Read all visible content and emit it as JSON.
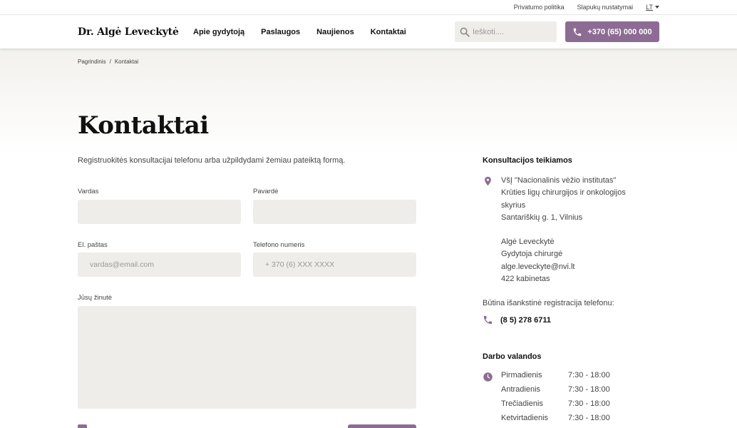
{
  "topbar": {
    "privacy": "Privatumo politika",
    "cookies": "Slapukų nustatymai",
    "lang": "LT"
  },
  "header": {
    "logo": "Dr. Algė Leveckytė",
    "nav": [
      "Apie gydytoją",
      "Paslaugos",
      "Naujienos",
      "Kontaktai"
    ],
    "search_placeholder": "Ieškoti....",
    "phone": "+370 (65) 000 000"
  },
  "breadcrumb": {
    "home": "Pagrindinis",
    "separator": "/",
    "current": "Kontaktai"
  },
  "page": {
    "title": "Kontaktai",
    "intro": "Registruokitės konsultacijai telefonu arba užpildydami žemiau pateiktą formą."
  },
  "form": {
    "first_name_label": "Vardas",
    "last_name_label": "Pavardė",
    "email_label": "El. paštas",
    "email_placeholder": "vardas@email.com",
    "phone_label": "Telefono numeris",
    "phone_placeholder": "+ 370 (6) XXX XXXX",
    "message_label": "Jūsų žinutė"
  },
  "sidebar": {
    "consult_title": "Konsultacijos teikiamos",
    "address": [
      "VšĮ \"Nacionalinis vėžio institutas\"",
      "Krūties ligų chirurgijos ir onkologijos",
      "skyrius",
      "Santariškių g. 1, Vilnius"
    ],
    "doctor": [
      "Algė Leveckytė",
      "Gydytoja chirurgė",
      "alge.leveckyte@nvi.lt",
      "422 kabinetas"
    ],
    "reg_note": "Būtina išankstinė registracija telefonu:",
    "reg_phone": "(8 5) 278 6711",
    "hours_title": "Darbo valandos",
    "hours": [
      {
        "day": "Pirmadienis",
        "time": "7:30 - 18:00"
      },
      {
        "day": "Antradienis",
        "time": "7:30 - 18:00"
      },
      {
        "day": "Trečiadienis",
        "time": "7:30 - 18:00"
      },
      {
        "day": "Ketvirtadienis",
        "time": "7:30 - 18:00"
      }
    ]
  },
  "colors": {
    "accent": "#8d6c93",
    "field_bg": "#eeede9",
    "hero_bg": "#f2f1ed"
  },
  "icons": {
    "search": "search-icon",
    "phone": "phone-icon",
    "location": "location-pin-icon",
    "clock": "clock-icon"
  }
}
